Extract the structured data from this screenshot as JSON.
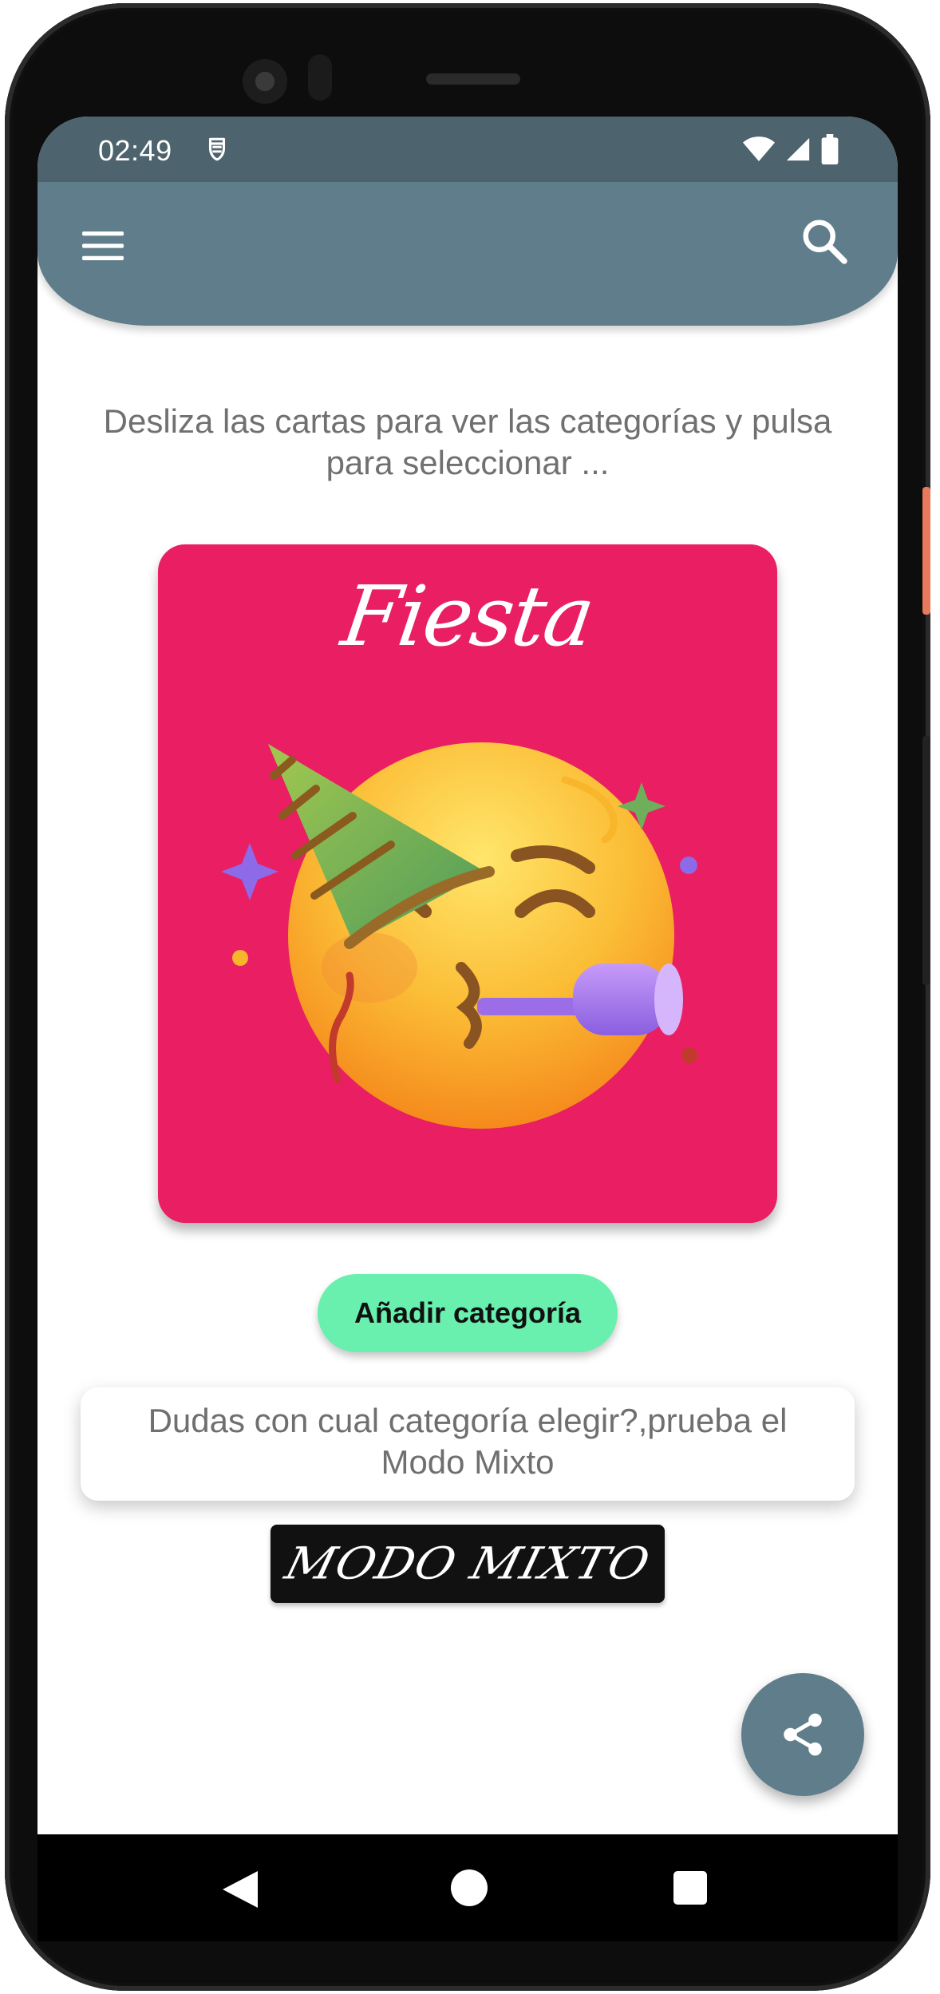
{
  "status_bar": {
    "time": "02:49",
    "icons": [
      "app-notification-icon",
      "wifi-icon",
      "signal-icon",
      "battery-icon"
    ]
  },
  "app_bar": {
    "menu_icon": "menu-icon",
    "search_icon": "search-icon",
    "color": "#607d8b"
  },
  "main": {
    "instruction": "Desliza las cartas para ver las categorías y pulsa para seleccionar ...",
    "card": {
      "title": "Fiesta",
      "image": "partying-face-emoji",
      "color": "#e91e63"
    },
    "add_button_label": "Añadir categoría",
    "add_button_color": "#69f0ae",
    "hint": "Dudas con cual categoría elegir?,prueba el Modo Mixto",
    "mixed_mode_label": "MODO MIXTO",
    "share_icon": "share-icon"
  },
  "nav_bar": {
    "back_icon": "back-icon",
    "home_icon": "home-icon",
    "recents_icon": "recents-icon"
  }
}
